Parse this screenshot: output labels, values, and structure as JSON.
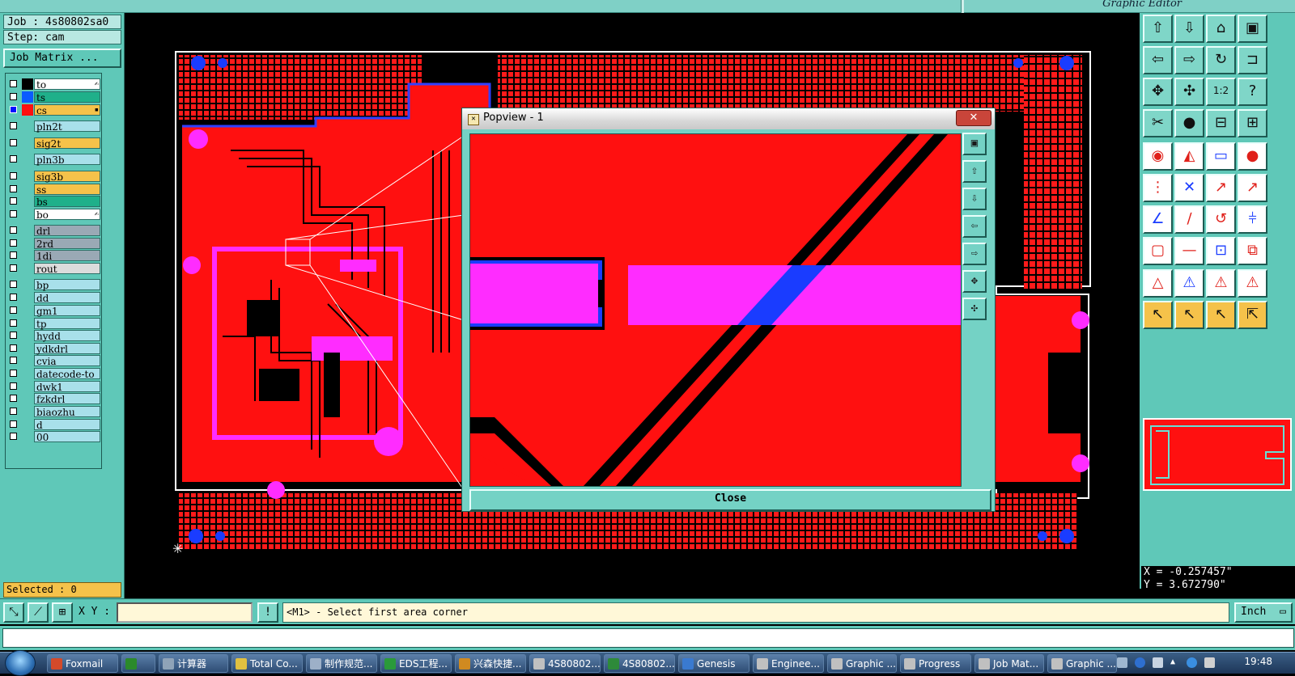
{
  "window": {
    "app_title": "Graphic Editor"
  },
  "left_panel": {
    "job": "Job : 4s80802sa0",
    "step": "Step: cam",
    "job_matrix_button": "Job Matrix ...",
    "layers": [
      {
        "name": "to",
        "checked": false,
        "color": "#000000",
        "bg": "#ffffff",
        "flag": "✍"
      },
      {
        "name": "ts",
        "checked": false,
        "color": "#0b5cff",
        "bg": "#1fb08a",
        "flag": ""
      },
      {
        "name": "cs",
        "checked": true,
        "color": "#ff1010",
        "bg": "#f5c24a",
        "flag": "▪"
      },
      {
        "name": "pln2t",
        "checked": false,
        "color": "",
        "bg": "#a8e0ea",
        "flag": ""
      },
      {
        "name": "sig2t",
        "checked": false,
        "color": "",
        "bg": "#f5c24a",
        "flag": ""
      },
      {
        "name": "pln3b",
        "checked": false,
        "color": "",
        "bg": "#a8e0ea",
        "flag": ""
      },
      {
        "name": "sig3b",
        "checked": false,
        "color": "",
        "bg": "#f5c24a",
        "flag": ""
      },
      {
        "name": "ss",
        "checked": false,
        "color": "",
        "bg": "#f5c24a",
        "flag": ""
      },
      {
        "name": "bs",
        "checked": false,
        "color": "",
        "bg": "#1fb08a",
        "flag": ""
      },
      {
        "name": "bo",
        "checked": false,
        "color": "",
        "bg": "#ffffff",
        "flag": "✍"
      },
      {
        "name": "drl",
        "checked": false,
        "color": "",
        "bg": "#9aa9b5",
        "flag": ""
      },
      {
        "name": "2rd",
        "checked": false,
        "color": "",
        "bg": "#9aa9b5",
        "flag": ""
      },
      {
        "name": "1di",
        "checked": false,
        "color": "",
        "bg": "#9aa9b5",
        "flag": ""
      },
      {
        "name": "rout",
        "checked": false,
        "color": "",
        "bg": "#dcdcdc",
        "flag": ""
      },
      {
        "name": "bp",
        "checked": false,
        "color": "",
        "bg": "#a8e0ea",
        "flag": ""
      },
      {
        "name": "dd",
        "checked": false,
        "color": "",
        "bg": "#a8e0ea",
        "flag": ""
      },
      {
        "name": "gm1",
        "checked": false,
        "color": "",
        "bg": "#a8e0ea",
        "flag": ""
      },
      {
        "name": "tp",
        "checked": false,
        "color": "",
        "bg": "#a8e0ea",
        "flag": ""
      },
      {
        "name": "hydd",
        "checked": false,
        "color": "",
        "bg": "#a8e0ea",
        "flag": ""
      },
      {
        "name": "ydkdrl",
        "checked": false,
        "color": "",
        "bg": "#a8e0ea",
        "flag": ""
      },
      {
        "name": "cvia",
        "checked": false,
        "color": "",
        "bg": "#a8e0ea",
        "flag": ""
      },
      {
        "name": "datecode-to",
        "checked": false,
        "color": "",
        "bg": "#a8e0ea",
        "flag": ""
      },
      {
        "name": "dwk1",
        "checked": false,
        "color": "",
        "bg": "#a8e0ea",
        "flag": ""
      },
      {
        "name": "fzkdrl",
        "checked": false,
        "color": "",
        "bg": "#a8e0ea",
        "flag": ""
      },
      {
        "name": "biaozhu",
        "checked": false,
        "color": "",
        "bg": "#a8e0ea",
        "flag": ""
      },
      {
        "name": "d",
        "checked": false,
        "color": "",
        "bg": "#a8e0ea",
        "flag": ""
      },
      {
        "name": "00",
        "checked": false,
        "color": "",
        "bg": "#a8e0ea",
        "flag": ""
      }
    ],
    "selected": "Selected : 0"
  },
  "popview": {
    "title": "Popview - 1",
    "close_x": "✕",
    "close_button": "Close",
    "tools": [
      "zoom-fit-icon",
      "page-up-icon",
      "page-down-icon",
      "page-left-icon",
      "page-right-icon",
      "zoom-home-icon",
      "zoom-center-icon"
    ]
  },
  "right_panel": {
    "tool_icons": [
      "pan-up-icon",
      "pan-down-icon",
      "home-icon",
      "window-icon",
      "pan-left-icon",
      "pan-right-icon",
      "redraw-icon",
      "snap-icon",
      "zoom-fit-icon",
      "zoom-center-icon",
      "scale-icon",
      "help-icon",
      "measure-icon",
      "pad-icon",
      "net-icon",
      "layer-icon",
      "pin-icon",
      "draw-icon",
      "ruler-icon",
      "dot-icon",
      "connect-icon",
      "x-icon",
      "line-icon",
      "line2-icon",
      "diag-icon",
      "diag2-icon",
      "rotate-icon",
      "mirror-icon",
      "box-icon",
      "minus-icon",
      "fit-icon",
      "group-icon",
      "warning-a-icon",
      "warning-b-icon",
      "warning-c-icon",
      "warning-d-icon",
      "cursor-icon",
      "cursor-box-icon",
      "cursor-sel-icon",
      "cursor-multi-icon"
    ],
    "tool_glyphs": [
      "⇧",
      "⇩",
      "⌂",
      "▣",
      "⇦",
      "⇨",
      "↻",
      "⊐",
      "✥",
      "✣",
      "1:2",
      "?",
      "✂",
      "●",
      "⊟",
      "⊞",
      "◉",
      "◭",
      "▭",
      "●",
      "⋮",
      "✕",
      "↗",
      "↗",
      "∠",
      "∕",
      "↺",
      "⫩",
      "▢",
      "—",
      "⊡",
      "⧉",
      "△",
      "⚠",
      "⚠",
      "⚠",
      "↖",
      "↖",
      "↖",
      "⇱"
    ],
    "coords": {
      "x": "X = -0.257457\"",
      "y": "Y = 3.672790\""
    }
  },
  "command": {
    "xy_label": "X Y :",
    "xy_value": "",
    "message": "<M1> - Select first area corner",
    "unit": "Inch",
    "exclaim": "!"
  },
  "taskbar": {
    "items": [
      {
        "label": "Foxmail",
        "color": "#d44a2a"
      },
      {
        "label": "",
        "color": "#2b8a2b"
      },
      {
        "label": "计算器",
        "color": "#8fa3b8"
      },
      {
        "label": "Total Co...",
        "color": "#e0c040"
      },
      {
        "label": "制作规范...",
        "color": "#9db0c8"
      },
      {
        "label": "EDS工程...",
        "color": "#2a9a3a"
      },
      {
        "label": "兴森快捷...",
        "color": "#d08a20"
      },
      {
        "label": "4S80802...",
        "color": "#c0c0c0"
      },
      {
        "label": "4S80802...",
        "color": "#2e8a3a"
      },
      {
        "label": "Genesis",
        "color": "#3a7ad0"
      },
      {
        "label": "Enginee...",
        "color": "#c0c0c0"
      },
      {
        "label": "Graphic ...",
        "color": "#c0c0c0"
      },
      {
        "label": "Progress",
        "color": "#c0c0c0"
      },
      {
        "label": "Job Mat...",
        "color": "#c0c0c0"
      },
      {
        "label": "Graphic ...",
        "color": "#c0c0c0"
      }
    ],
    "clock": "19:48"
  }
}
